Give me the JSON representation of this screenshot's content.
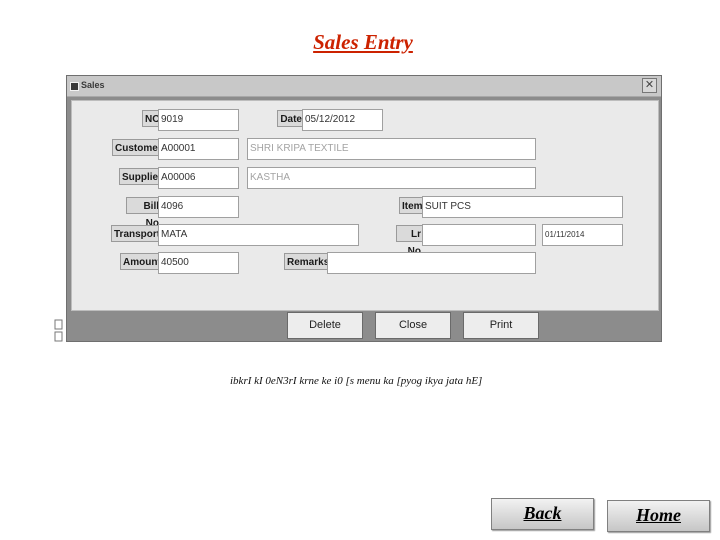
{
  "page": {
    "title": "Sales Entry",
    "caption": "ibkrI kI 0eN3rI krne ke i0 [s menu ka [pyog ikya jata hE]"
  },
  "window": {
    "title": "Sales",
    "close_glyph": "✕"
  },
  "form": {
    "no": {
      "label": "NO",
      "value": "9019"
    },
    "date": {
      "label": "Date",
      "value": "05/12/2012"
    },
    "customer": {
      "label": "Customer",
      "code": "A00001",
      "name": "SHRI KRIPA TEXTILE"
    },
    "supplier": {
      "label": "Supplier",
      "code": "A00006",
      "name": "KASTHA"
    },
    "bill_no": {
      "label": "Bill No",
      "value": "4096"
    },
    "item": {
      "label": "Item",
      "value": "SUIT PCS"
    },
    "transport": {
      "label": "Transport",
      "value": "MATA"
    },
    "lr_no": {
      "label": "Lr No",
      "value": "",
      "date": "01/11/2014"
    },
    "amount": {
      "label": "Amount",
      "value": "40500"
    },
    "remarks": {
      "label": "Remarks",
      "value": ""
    }
  },
  "buttons": {
    "delete": "Delete",
    "close": "Close",
    "print": "Print"
  },
  "nav": {
    "back": "Back",
    "home": "Home"
  }
}
